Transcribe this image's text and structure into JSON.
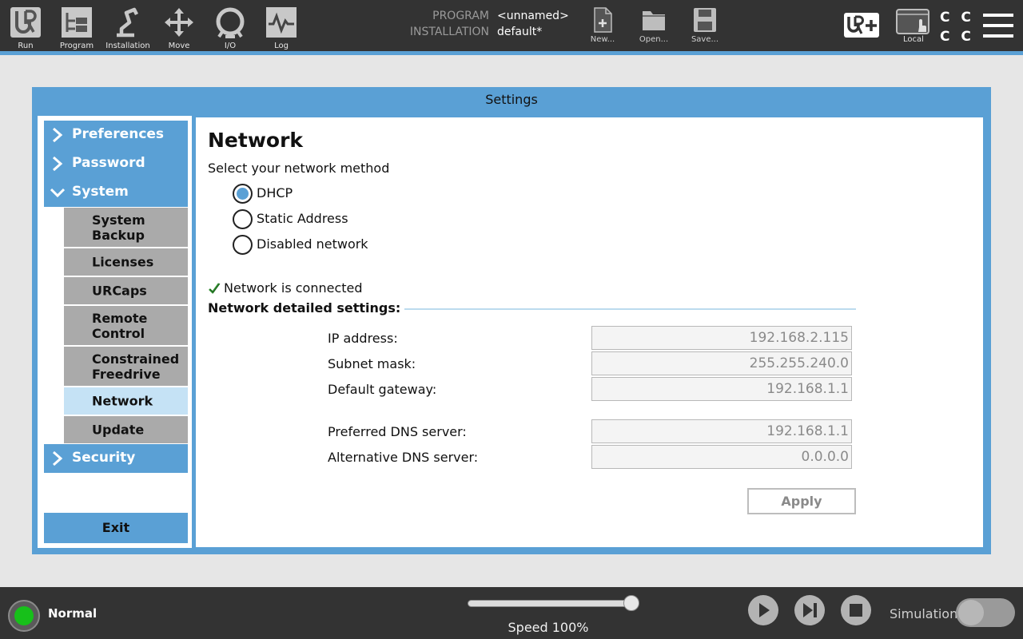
{
  "topbar": {
    "nav": [
      {
        "label": "Run",
        "icon": "ur-logo-icon"
      },
      {
        "label": "Program",
        "icon": "program-tree-icon"
      },
      {
        "label": "Installation",
        "icon": "robot-arm-icon"
      },
      {
        "label": "Move",
        "icon": "move-arrows-icon"
      },
      {
        "label": "I/O",
        "icon": "io-icon"
      },
      {
        "label": "Log",
        "icon": "log-graph-icon"
      }
    ],
    "program_key": "PROGRAM",
    "program_value": "<unnamed>",
    "installation_key": "INSTALLATION",
    "installation_value": "default*",
    "file": [
      {
        "label": "New...",
        "icon": "new-file-icon"
      },
      {
        "label": "Open...",
        "icon": "open-folder-icon"
      },
      {
        "label": "Save...",
        "icon": "save-icon"
      }
    ],
    "local_label": "Local",
    "cc_text": "C C\nC C",
    "colors": {
      "bar": "#333333",
      "accent": "#5aa0d5"
    }
  },
  "settings": {
    "window_title": "Settings",
    "sidebar": {
      "items": [
        {
          "label": "Preferences",
          "expanded": false
        },
        {
          "label": "Password",
          "expanded": false
        },
        {
          "label": "System",
          "expanded": true
        }
      ],
      "sub_items": [
        {
          "label": "System\nBackup"
        },
        {
          "label": "Licenses"
        },
        {
          "label": "URCaps"
        },
        {
          "label": "Remote\nControl"
        },
        {
          "label": "Constrained\nFreedrive"
        },
        {
          "label": "Network",
          "active": true
        },
        {
          "label": "Update"
        }
      ],
      "security_label": "Security",
      "exit_label": "Exit"
    },
    "network": {
      "title": "Network",
      "method_label": "Select your network method",
      "options": [
        "DHCP",
        "Static Address",
        "Disabled network"
      ],
      "selected": "DHCP",
      "status": "Network is connected",
      "details_heading": "Network detailed settings:",
      "fields": [
        {
          "label": "IP address:",
          "value": "192.168.2.115"
        },
        {
          "label": "Subnet mask:",
          "value": "255.255.240.0"
        },
        {
          "label": "Default gateway:",
          "value": "192.168.1.1"
        },
        {
          "label": "Preferred DNS server:",
          "value": "192.168.1.1"
        },
        {
          "label": "Alternative DNS server:",
          "value": "0.0.0.0"
        }
      ],
      "apply_label": "Apply"
    }
  },
  "bottombar": {
    "status": "Normal",
    "status_color": "#17c01a",
    "speed_text": "Speed 100%",
    "speed_percent": 100,
    "simulation_label": "Simulation",
    "simulation_on": false
  }
}
